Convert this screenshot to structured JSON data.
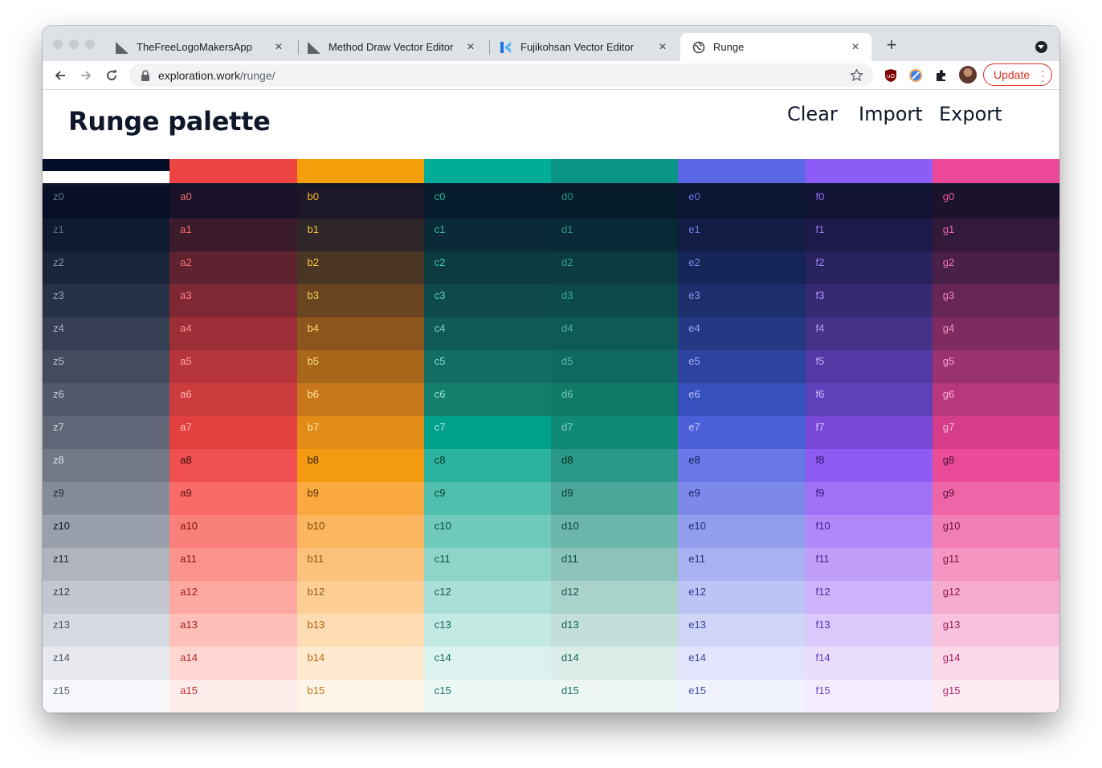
{
  "browser": {
    "tabs": [
      {
        "title": "TheFreeLogoMakersApp",
        "icon": "logo-maker-favicon-icon",
        "active": false
      },
      {
        "title": "Method Draw Vector Editor",
        "icon": "method-draw-favicon-icon",
        "active": false
      },
      {
        "title": "Fujikohsan Vector Editor",
        "icon": "fujikohsan-favicon-icon",
        "active": false
      },
      {
        "title": "Runge",
        "icon": "globe-icon",
        "active": true
      }
    ],
    "url_host": "exploration.work",
    "url_path": "/runge/",
    "update_label": "Update"
  },
  "page": {
    "title": "Runge palette",
    "actions": {
      "clear": "Clear",
      "import": "Import",
      "export": "Export"
    }
  },
  "palette": {
    "columns": [
      {
        "key": "z",
        "base": "#030e29",
        "top_split": true
      },
      {
        "key": "a",
        "base": "#ef4444"
      },
      {
        "key": "b",
        "base": "#f59e0b"
      },
      {
        "key": "c",
        "base": "#00ad98"
      },
      {
        "key": "d",
        "base": "#0d9488"
      },
      {
        "key": "e",
        "base": "#5b67e4"
      },
      {
        "key": "f",
        "base": "#8b5cf6"
      },
      {
        "key": "g",
        "base": "#ec4899"
      }
    ],
    "rows": [
      [
        "#070f26",
        "#181127",
        "#1c1729",
        "#051a2a",
        "#061b2a",
        "#0c1633",
        "#121234",
        "#1b122b"
      ],
      [
        "#0f1a30",
        "#3c1c2b",
        "#2e2627",
        "#092a36",
        "#082a36",
        "#111d45",
        "#1c1a4a",
        "#331a3a"
      ],
      [
        "#1b2539",
        "#5e2230",
        "#4b3524",
        "#0c3a40",
        "#0b3a40",
        "#162558",
        "#28225f",
        "#4a1f48"
      ],
      [
        "#283247",
        "#7f2834",
        "#6a4521",
        "#0e4a4c",
        "#0d4a4a",
        "#1c2e6c",
        "#362a73",
        "#652555"
      ],
      [
        "#353e52",
        "#9c2e37",
        "#8b561e",
        "#105b57",
        "#0e5a54",
        "#243884",
        "#45338a",
        "#7f2b61"
      ],
      [
        "#434b5f",
        "#b6353a",
        "#a8671b",
        "#136d62",
        "#10695e",
        "#2c43a0",
        "#5239a3",
        "#9a3170"
      ],
      [
        "#52596c",
        "#cc3b3e",
        "#c8771a",
        "#157f6d",
        "#107a69",
        "#3650bd",
        "#5f40bb",
        "#b8387e"
      ],
      [
        "#616778",
        "#e1403f",
        "#e38b17",
        "#00a08a",
        "#0f8a77",
        "#4b5fd8",
        "#7848d6",
        "#d53c89"
      ],
      [
        "#727887",
        "#f15050",
        "#f49a12",
        "#2bb3a0",
        "#2a9888",
        "#6878e6",
        "#8e5cf2",
        "#e94b98"
      ],
      [
        "#868b98",
        "#f86b68",
        "#f9a93f",
        "#50bfae",
        "#4aa79a",
        "#7c89eb",
        "#a070f7",
        "#ee66a8"
      ],
      [
        "#9aa0ab",
        "#fa817b",
        "#fbb65f",
        "#6fcabc",
        "#6db6ab",
        "#929dee",
        "#b188f8",
        "#f17eb5"
      ],
      [
        "#b0b4bd",
        "#fb948d",
        "#fcc27b",
        "#8ed5c9",
        "#8cc4ba",
        "#a8b1f1",
        "#c09ef9",
        "#f495c2"
      ],
      [
        "#c4c7cf",
        "#fda9a2",
        "#fdcf97",
        "#a9dfd6",
        "#a9d2ca",
        "#bdc3f4",
        "#cdb3fa",
        "#f7abcf"
      ],
      [
        "#d7d9e0",
        "#fdbfb8",
        "#fedcb3",
        "#c3e9e3",
        "#c3dfd9",
        "#d0d5f7",
        "#dbc9fb",
        "#f9c2dc"
      ],
      [
        "#e8e9ee",
        "#fdd6d1",
        "#fee8cf",
        "#dbf2ee",
        "#dbece8",
        "#e1e4fa",
        "#e9ddfc",
        "#fbd8e8"
      ],
      [
        "#f5f7fb",
        "#feecea",
        "#fff4e8",
        "#ecf8f6",
        "#edf6f4",
        "#f0f2fd",
        "#f3ecfd",
        "#fdebf3"
      ]
    ],
    "text_colors": {
      "z": [
        "#64748b",
        "#5c6b82",
        "#8592a6",
        "#97a3b6",
        "#aab4c4",
        "#b8c0cd",
        "#c5ccd6",
        "#d2d7df",
        "#dce0e6",
        "#1e293b",
        "#101828",
        "#1e293b",
        "#334155",
        "#475569",
        "#4b5563",
        "#5b6475"
      ],
      "a": [
        "#f87171",
        "#ff6b6b",
        "#f87171",
        "#fc8181",
        "#fb8a8a",
        "#ffa4a4",
        "#ffb7b5",
        "#ffc3c0",
        "#3a0a0a",
        "#5a0f10",
        "#7a1412",
        "#8a1818",
        "#9b1c1c",
        "#a31f1f",
        "#b32626",
        "#c12b2b"
      ],
      "b": [
        "#fbbf24",
        "#fcc33a",
        "#fcc640",
        "#fccf55",
        "#fcd86c",
        "#fddf88",
        "#fde4a0",
        "#fde7b0",
        "#2e1a03",
        "#5a3206",
        "#7c4608",
        "#8e520a",
        "#9a5a0c",
        "#a5620e",
        "#b26c12",
        "#bd7614"
      ],
      "c": [
        "#20b8a3",
        "#34c0ad",
        "#46c7b5",
        "#5bcfbf",
        "#6fd5c6",
        "#84dccf",
        "#99e2d7",
        "#b3ebe2",
        "#0a2f2b",
        "#0c3c37",
        "#0e4943",
        "#0f524b",
        "#105a52",
        "#126259",
        "#136a60",
        "#147267"
      ],
      "d": [
        "#1b9488",
        "#229a8e",
        "#2ba195",
        "#38a99d",
        "#48b1a6",
        "#5cbaaf",
        "#74c5bb",
        "#8ecfc6",
        "#082a26",
        "#0a3530",
        "#0c403a",
        "#0d4a43",
        "#0e534b",
        "#0f5b53",
        "#10635b",
        "#126b62"
      ],
      "e": [
        "#6874e8",
        "#717ceb",
        "#7d88ee",
        "#8a95f0",
        "#98a2f2",
        "#a8b0f4",
        "#b7bef6",
        "#c6ccf8",
        "#141c55",
        "#1b2466",
        "#212c76",
        "#263380",
        "#2c3a8c",
        "#324196",
        "#3848a0",
        "#3e4faa"
      ],
      "f": [
        "#9470f5",
        "#9c7bf6",
        "#a586f7",
        "#b092f8",
        "#ba9ef9",
        "#c5abfa",
        "#d0b9fb",
        "#dbc8fc",
        "#2a1360",
        "#361a75",
        "#42208a",
        "#4b2596",
        "#552aa2",
        "#5f2fad",
        "#6834b8",
        "#7139c2"
      ],
      "g": [
        "#ee5ca5",
        "#f06aad",
        "#f278b5",
        "#f386bd",
        "#f594c5",
        "#f7a3ce",
        "#f8b1d6",
        "#fabfde",
        "#4a0e2c",
        "#5a1136",
        "#6b1440",
        "#791749",
        "#871a52",
        "#941d5b",
        "#a12063",
        "#ad236b"
      ]
    }
  }
}
